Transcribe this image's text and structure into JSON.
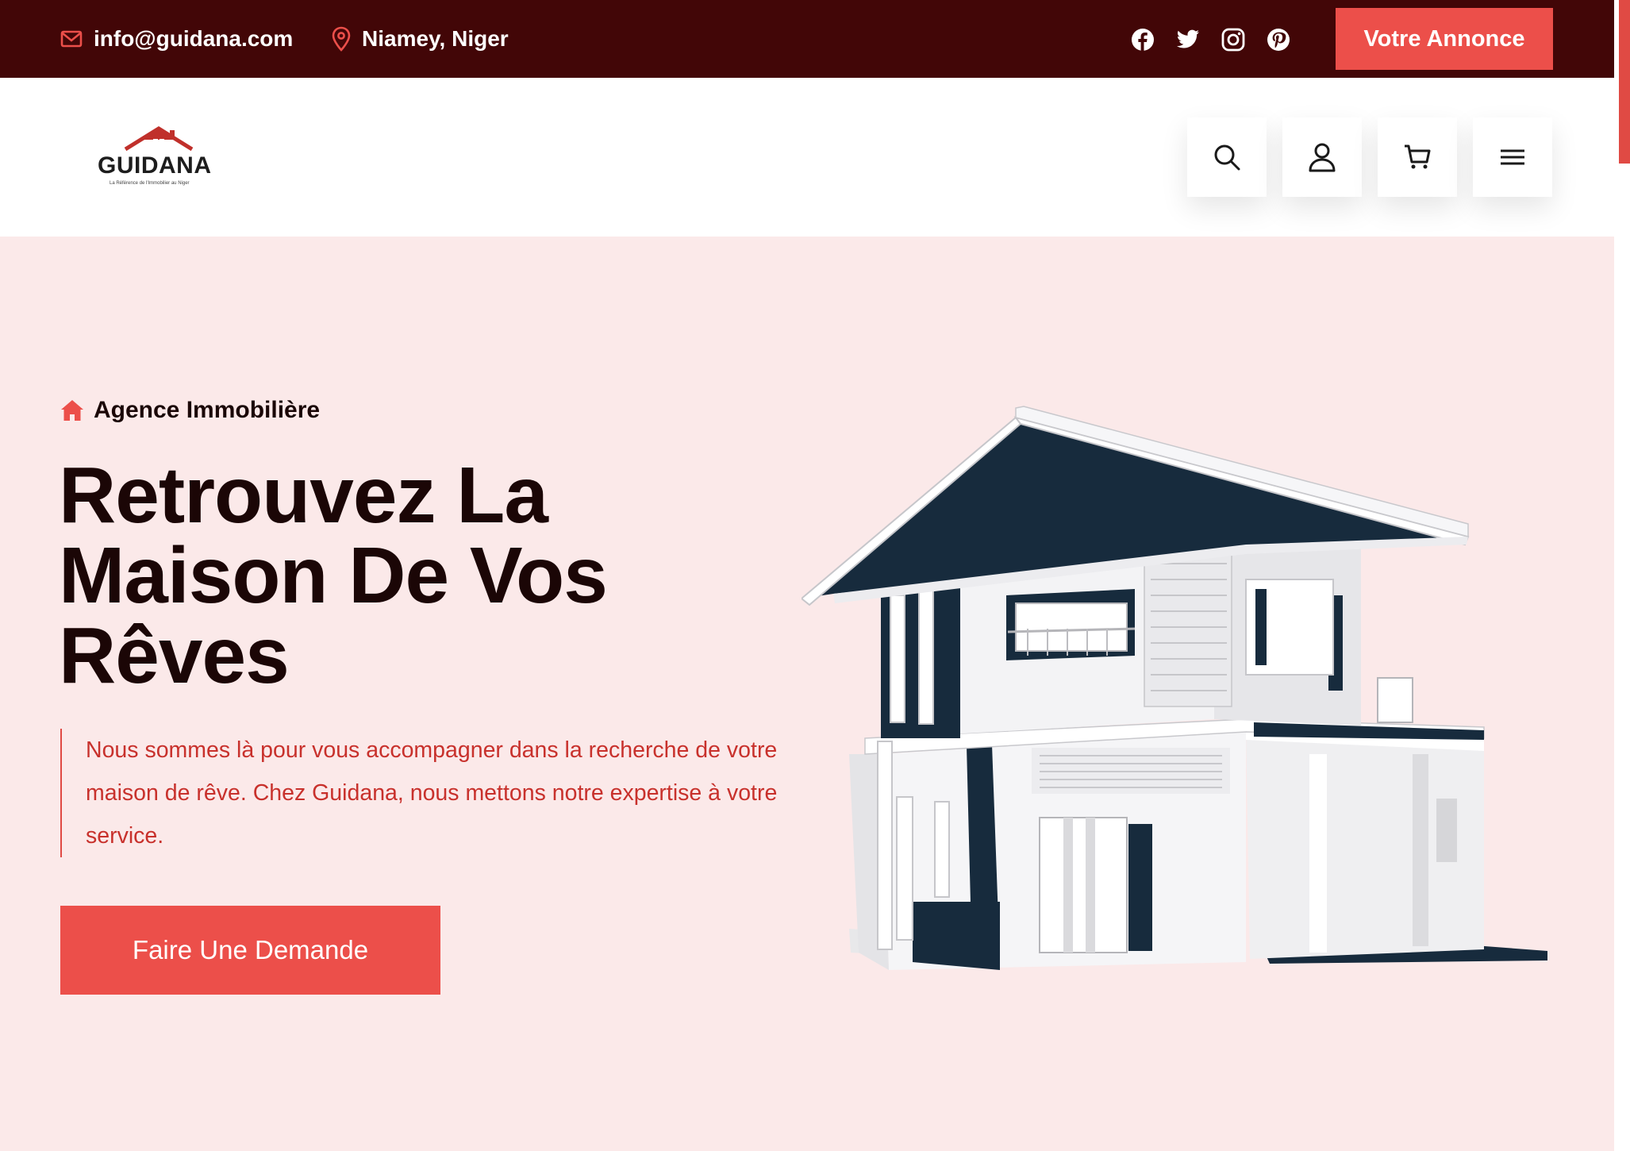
{
  "topbar": {
    "email": "info@guidana.com",
    "location": "Niamey, Niger",
    "announce_label": "Votre Annonce",
    "socials": [
      "facebook-icon",
      "twitter-icon",
      "instagram-icon",
      "pinterest-icon"
    ]
  },
  "header": {
    "logo_text": "GUIDANA",
    "logo_tagline": "La Référence de l'Immobilier au Niger",
    "icons": [
      "search-icon",
      "user-icon",
      "cart-icon",
      "menu-icon"
    ]
  },
  "hero": {
    "eyebrow": "Agence Immobilière",
    "title_line1": "Retrouvez La",
    "title_line2": "Maison De Vos",
    "title_line3": "Rêves",
    "description": "Nous sommes là pour vous accompagner dans la recherche de votre maison de rêve. Chez Guidana, nous mettons notre expertise à votre service.",
    "cta_label": "Faire Une Demande"
  },
  "colors": {
    "topbar_bg": "#420607",
    "accent": "#ec4f4a",
    "hero_bg": "#fbe9e9",
    "heading": "#1b0606",
    "description": "#c8312c",
    "house_dark": "#172b3d"
  }
}
